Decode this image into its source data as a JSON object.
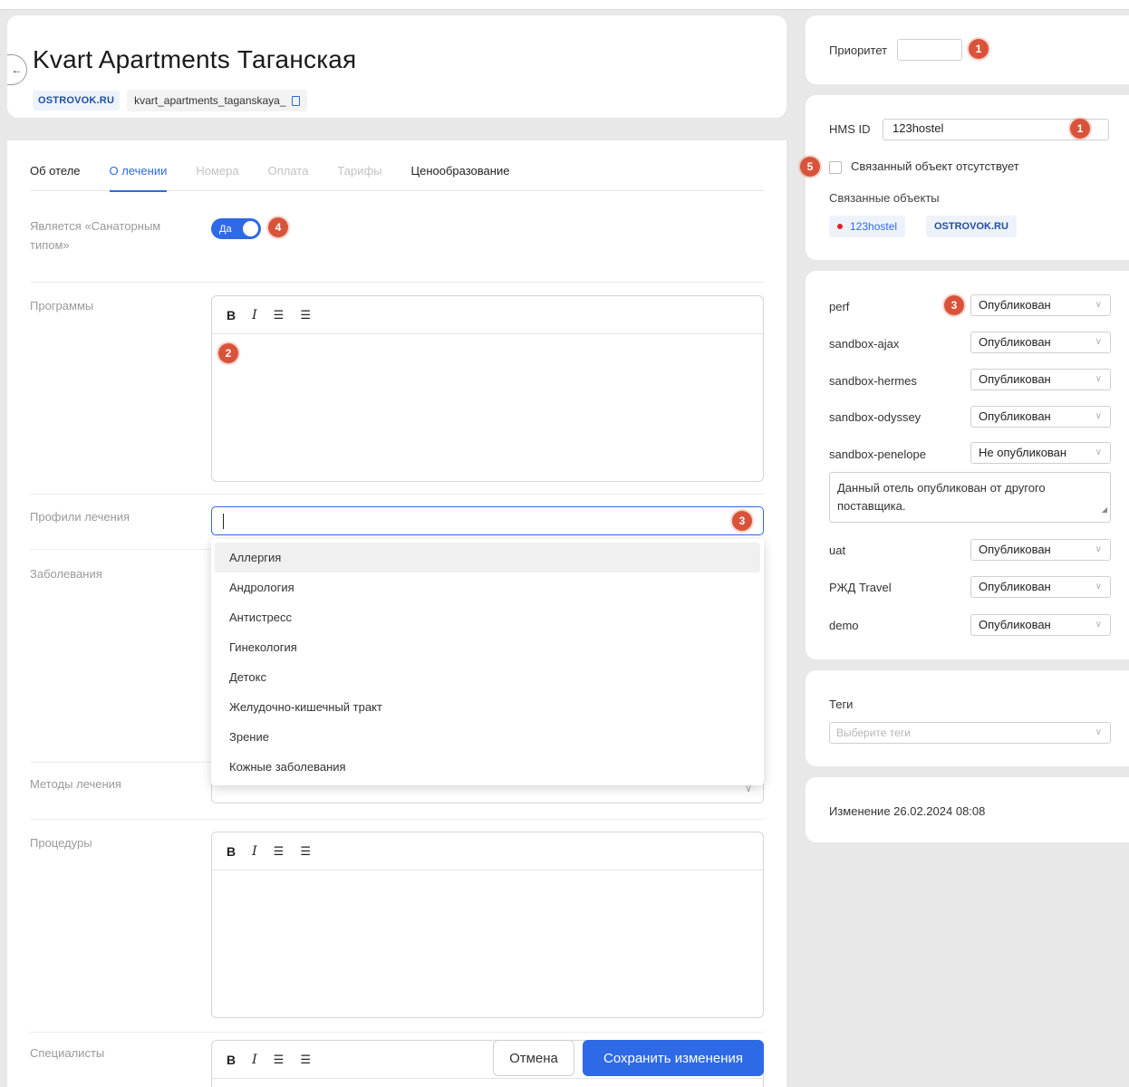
{
  "header": {
    "title": "Kvart Apartments Таганская",
    "back_icon": "←",
    "source_badge": "OSTROVOK.RU",
    "slug": "kvart_apartments_taganskaya_"
  },
  "tabs": [
    {
      "label": "Об отеле",
      "state": "normal"
    },
    {
      "label": "О лечении",
      "state": "active"
    },
    {
      "label": "Номера",
      "state": "disabled"
    },
    {
      "label": "Оплата",
      "state": "disabled"
    },
    {
      "label": "Тарифы",
      "state": "disabled"
    },
    {
      "label": "Ценообразование",
      "state": "normal"
    }
  ],
  "form": {
    "sanatorium_label": "Является «Санаторным типом»",
    "sanatorium_toggle": "Да",
    "programs_label": "Программы",
    "profiles_label": "Профили лечения",
    "diseases_label": "Заболевания",
    "methods_label": "Методы лечения",
    "procedures_label": "Процедуры",
    "specialists_label": "Специалисты",
    "rte_bold": "B",
    "rte_italic": "I",
    "rte_bullets": "☰",
    "rte_numbered": "☰"
  },
  "dropdown": {
    "options": [
      "Аллергия",
      "Андрология",
      "Антистресс",
      "Гинекология",
      "Детокс",
      "Желудочно-кишечный тракт",
      "Зрение",
      "Кожные заболевания"
    ]
  },
  "actions": {
    "cancel": "Отмена",
    "save": "Сохранить изменения"
  },
  "markers": {
    "m1": "1",
    "m2": "2",
    "m3": "3",
    "m4": "4",
    "m5": "5"
  },
  "sidebar": {
    "priority_label": "Приоритет",
    "priority_value": "",
    "hms_label": "HMS ID",
    "hms_value": "123hostel",
    "no_linked_label": "Связанный объект отсутствует",
    "linked_label": "Связанные объекты",
    "linked_name": "123hostel",
    "linked_badge": "OSTROVOK.RU",
    "publications": [
      {
        "env": "perf",
        "status": "Опубликован"
      },
      {
        "env": "sandbox-ajax",
        "status": "Опубликован"
      },
      {
        "env": "sandbox-hermes",
        "status": "Опубликован"
      },
      {
        "env": "sandbox-odyssey",
        "status": "Опубликован"
      },
      {
        "env": "sandbox-penelope",
        "status": "Не опубликован"
      },
      {
        "env": "uat",
        "status": "Опубликован"
      },
      {
        "env": "РЖД Travel",
        "status": "Опубликован"
      },
      {
        "env": "demo",
        "status": "Опубликован"
      }
    ],
    "penelope_note": "Данный отель опубликован от другого поставщика.",
    "tags_label": "Теги",
    "tags_placeholder": "Выберите теги",
    "changed_label": "Изменение 26.02.2024 08:08"
  },
  "colors": {
    "accent": "#2e6ae6",
    "marker": "#d9533a",
    "page_bg": "#e8e8e8"
  }
}
